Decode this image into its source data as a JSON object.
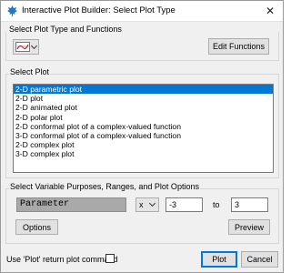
{
  "window": {
    "title": "Interactive Plot Builder: Select Plot Type",
    "icon": "maple-leaf-icon",
    "close_glyph": "✕"
  },
  "plot_type_section": {
    "label": "Select Plot Type and Functions",
    "edit_functions_label": "Edit Functions"
  },
  "plot_list_section": {
    "label": "Select Plot",
    "items": [
      "2-D parametric plot",
      "2-D plot",
      "2-D animated plot",
      "2-D polar plot",
      "2-D conformal plot of a complex-valued function",
      "3-D conformal plot of a complex-valued function",
      "2-D complex plot",
      "3-D complex plot"
    ],
    "selected_index": 0
  },
  "range_section": {
    "label": "Select Variable Purposes, Ranges, and Plot Options",
    "purpose_value": "Parameter",
    "variable_value": "x",
    "range_from": "-3",
    "range_to_label": "to",
    "range_to": "3",
    "options_label": "Options",
    "preview_label": "Preview"
  },
  "footer": {
    "return_command_label": "Use 'Plot' return plot command",
    "return_command_checked": false,
    "plot_label": "Plot",
    "cancel_label": "Cancel"
  },
  "colors": {
    "selection": "#0078d7",
    "dialog_bg": "#f0f0f0"
  }
}
